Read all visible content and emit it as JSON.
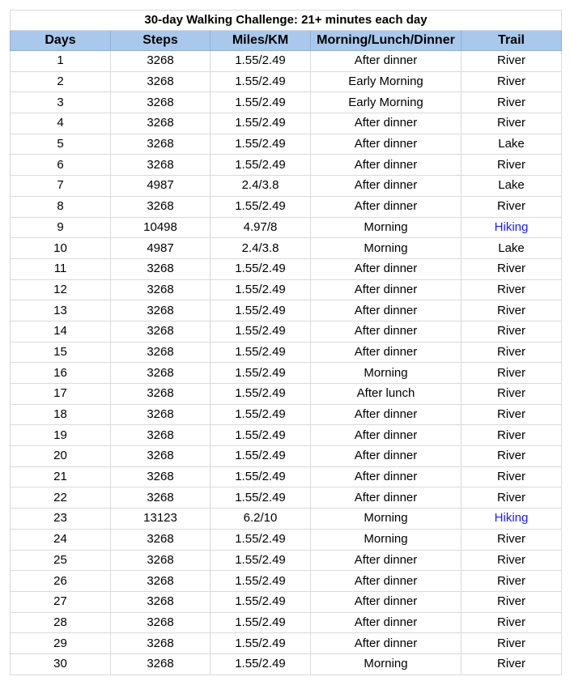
{
  "title": "30-day Walking Challenge: 21+ minutes each day",
  "columns": [
    "Days",
    "Steps",
    "Miles/KM",
    "Morning/Lunch/Dinner",
    "Trail"
  ],
  "colors": {
    "header_bg": "#a9c8ec",
    "link_text": "#1a1aff",
    "grid": "#dadada"
  },
  "rows": [
    {
      "day": "1",
      "steps": "3268",
      "distance": "1.55/2.49",
      "time": "After dinner",
      "trail": "River",
      "link": false
    },
    {
      "day": "2",
      "steps": "3268",
      "distance": "1.55/2.49",
      "time": "Early Morning",
      "trail": "River",
      "link": false
    },
    {
      "day": "3",
      "steps": "3268",
      "distance": "1.55/2.49",
      "time": "Early Morning",
      "trail": "River",
      "link": false
    },
    {
      "day": "4",
      "steps": "3268",
      "distance": "1.55/2.49",
      "time": "After dinner",
      "trail": "River",
      "link": false
    },
    {
      "day": "5",
      "steps": "3268",
      "distance": "1.55/2.49",
      "time": "After dinner",
      "trail": "Lake",
      "link": false
    },
    {
      "day": "6",
      "steps": "3268",
      "distance": "1.55/2.49",
      "time": "After dinner",
      "trail": "River",
      "link": false
    },
    {
      "day": "7",
      "steps": "4987",
      "distance": "2.4/3.8",
      "time": "After dinner",
      "trail": "Lake",
      "link": false
    },
    {
      "day": "8",
      "steps": "3268",
      "distance": "1.55/2.49",
      "time": "After dinner",
      "trail": "River",
      "link": false
    },
    {
      "day": "9",
      "steps": "10498",
      "distance": "4.97/8",
      "time": "Morning",
      "trail": "Hiking",
      "link": true
    },
    {
      "day": "10",
      "steps": "4987",
      "distance": "2.4/3.8",
      "time": "Morning",
      "trail": "Lake",
      "link": false
    },
    {
      "day": "11",
      "steps": "3268",
      "distance": "1.55/2.49",
      "time": "After dinner",
      "trail": "River",
      "link": false
    },
    {
      "day": "12",
      "steps": "3268",
      "distance": "1.55/2.49",
      "time": "After dinner",
      "trail": "River",
      "link": false
    },
    {
      "day": "13",
      "steps": "3268",
      "distance": "1.55/2.49",
      "time": "After dinner",
      "trail": "River",
      "link": false
    },
    {
      "day": "14",
      "steps": "3268",
      "distance": "1.55/2.49",
      "time": "After dinner",
      "trail": "River",
      "link": false
    },
    {
      "day": "15",
      "steps": "3268",
      "distance": "1.55/2.49",
      "time": "After dinner",
      "trail": "River",
      "link": false
    },
    {
      "day": "16",
      "steps": "3268",
      "distance": "1.55/2.49",
      "time": "Morning",
      "trail": "River",
      "link": false
    },
    {
      "day": "17",
      "steps": "3268",
      "distance": "1.55/2.49",
      "time": "After lunch",
      "trail": "River",
      "link": false
    },
    {
      "day": "18",
      "steps": "3268",
      "distance": "1.55/2.49",
      "time": "After dinner",
      "trail": "River",
      "link": false
    },
    {
      "day": "19",
      "steps": "3268",
      "distance": "1.55/2.49",
      "time": "After dinner",
      "trail": "River",
      "link": false
    },
    {
      "day": "20",
      "steps": "3268",
      "distance": "1.55/2.49",
      "time": "After dinner",
      "trail": "River",
      "link": false
    },
    {
      "day": "21",
      "steps": "3268",
      "distance": "1.55/2.49",
      "time": "After dinner",
      "trail": "River",
      "link": false
    },
    {
      "day": "22",
      "steps": "3268",
      "distance": "1.55/2.49",
      "time": "After dinner",
      "trail": "River",
      "link": false
    },
    {
      "day": "23",
      "steps": "13123",
      "distance": "6.2/10",
      "time": "Morning",
      "trail": "Hiking",
      "link": true
    },
    {
      "day": "24",
      "steps": "3268",
      "distance": "1.55/2.49",
      "time": "Morning",
      "trail": "River",
      "link": false
    },
    {
      "day": "25",
      "steps": "3268",
      "distance": "1.55/2.49",
      "time": "After dinner",
      "trail": "River",
      "link": false
    },
    {
      "day": "26",
      "steps": "3268",
      "distance": "1.55/2.49",
      "time": "After dinner",
      "trail": "River",
      "link": false
    },
    {
      "day": "27",
      "steps": "3268",
      "distance": "1.55/2.49",
      "time": "After dinner",
      "trail": "River",
      "link": false
    },
    {
      "day": "28",
      "steps": "3268",
      "distance": "1.55/2.49",
      "time": "After dinner",
      "trail": "River",
      "link": false
    },
    {
      "day": "29",
      "steps": "3268",
      "distance": "1.55/2.49",
      "time": "After dinner",
      "trail": "River",
      "link": false
    },
    {
      "day": "30",
      "steps": "3268",
      "distance": "1.55/2.49",
      "time": "Morning",
      "trail": "River",
      "link": false
    }
  ]
}
